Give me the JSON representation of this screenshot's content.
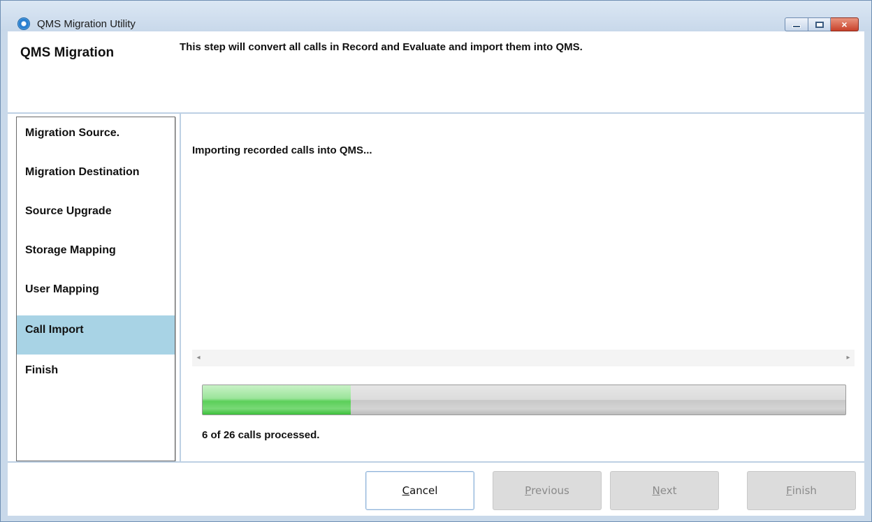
{
  "window": {
    "title": "QMS Migration Utility",
    "icon": "app-logo-icon",
    "controls": {
      "minimize": "minimize-icon",
      "maximize": "maximize-icon",
      "close": "×"
    }
  },
  "header": {
    "title": "QMS Migration",
    "description": "This step will convert all calls in Record and Evaluate and import them into QMS."
  },
  "sidebar": {
    "items": [
      {
        "label": "Migration Source."
      },
      {
        "label": "Migration Destination"
      },
      {
        "label": "Source Upgrade"
      },
      {
        "label": "Storage Mapping"
      },
      {
        "label": "User Mapping"
      },
      {
        "label": "Call Import",
        "active": true
      },
      {
        "label": "Finish"
      }
    ]
  },
  "content": {
    "status": "Importing recorded calls into QMS...",
    "scroll_left": "◂",
    "scroll_right": "▸",
    "progress": {
      "fraction": 0.23,
      "caption": "6 of 26 calls processed."
    }
  },
  "footer": {
    "cancel": {
      "key": "C",
      "rest": "ancel"
    },
    "previous": {
      "key": "P",
      "rest": "revious"
    },
    "next": {
      "key": "N",
      "rest": "ext"
    },
    "finish": {
      "key": "F",
      "rest": "inish"
    }
  },
  "colors": {
    "active_item": "#a8d3e5",
    "progress_green": "#5ccf5a",
    "disabled_button": "#dcdcdc",
    "close_button": "#c8412a"
  }
}
